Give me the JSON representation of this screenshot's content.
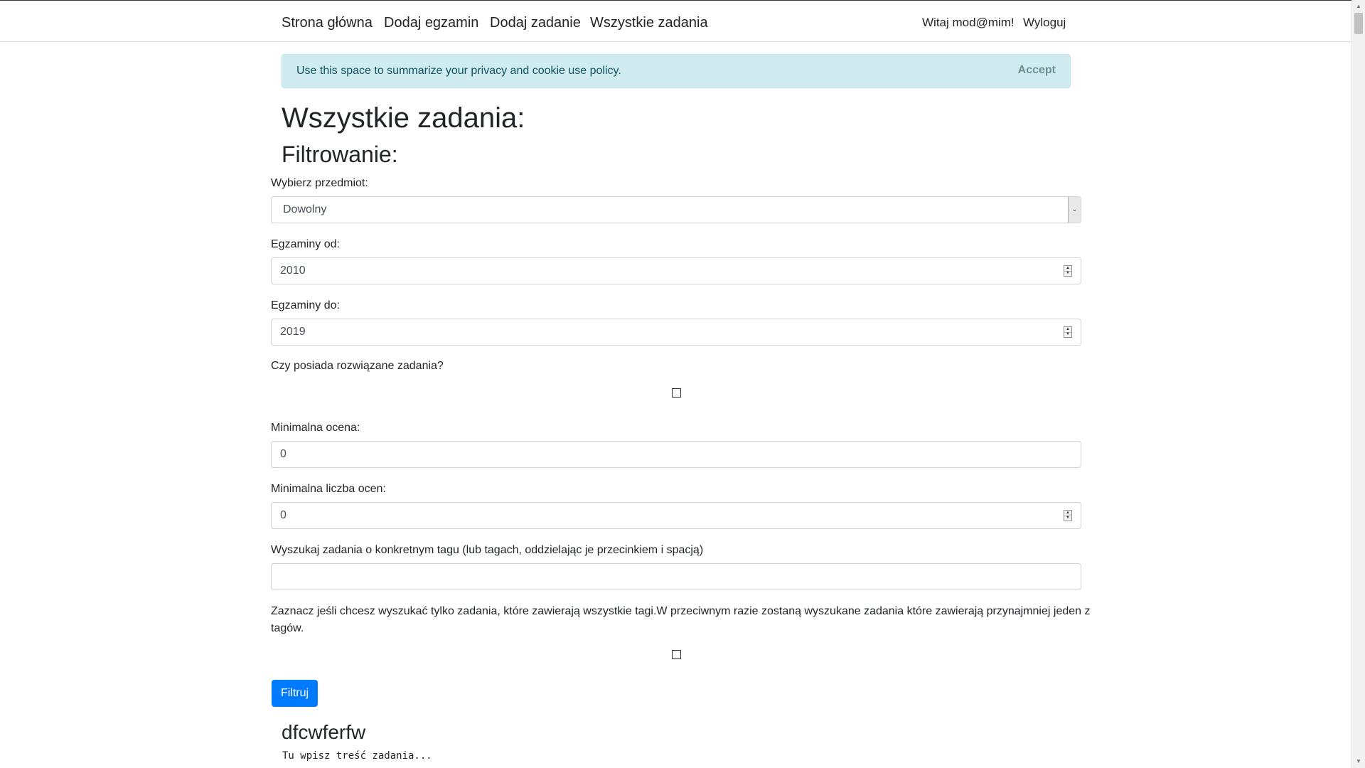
{
  "nav": {
    "links": [
      "Strona główna",
      "Dodaj egzamin",
      "Dodaj zadanie",
      "Wszystkie zadania"
    ],
    "greeting": "Witaj mod@mim!",
    "logout": "Wyloguj"
  },
  "cookie": {
    "text": "Use this space to summarize your privacy and cookie use policy.",
    "accept": "Accept"
  },
  "page": {
    "title": "Wszystkie zadania:",
    "subtitle": "Filtrowanie:"
  },
  "filters": {
    "subject_label": "Wybierz przedmiot:",
    "subject_value": "Dowolny",
    "from_label": "Egzaminy od:",
    "from_value": "2010",
    "to_label": "Egzaminy do:",
    "to_value": "2019",
    "solved_label": "Czy posiada rozwiązane zadania?",
    "min_grade_label": "Minimalna ocena:",
    "min_grade_value": "0",
    "min_count_label": "Minimalna liczba ocen:",
    "min_count_value": "0",
    "tags_label": "Wyszukaj zadania o konkretnym tagu (lub tagach, oddzielając je przecinkiem i spacją)",
    "tags_value": "",
    "all_tags_label_line1": "Zaznacz jeśli chcesz wyszukać tylko zadania, które zawierają wszystkie tagi.W przeciwnym razie zostaną wyszukane zadania które zawierają przynajmniej jeden z",
    "all_tags_label_line2": "tagów.",
    "submit": "Filtruj"
  },
  "task": {
    "title": "dfcwferfw",
    "body": "Tu wpisz treść zadania..."
  }
}
